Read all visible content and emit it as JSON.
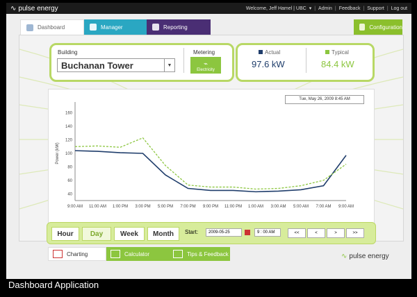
{
  "topbar": {
    "logo": "pulse energy",
    "welcome": "Welcome, Jeff Hamel | UBC",
    "links": [
      "Admin",
      "Feedback",
      "Support",
      "Log out"
    ]
  },
  "tabs": [
    {
      "label": "Dashboard",
      "icon": "dashboard-icon"
    },
    {
      "label": "Manager",
      "icon": "manager-icon"
    },
    {
      "label": "Reporting",
      "icon": "reporting-icon"
    },
    {
      "label": "Configuration",
      "icon": "configuration-icon"
    }
  ],
  "building": {
    "label": "Building",
    "selected": "Buchanan Tower"
  },
  "metering": {
    "label": "Metering",
    "button": "Electricity"
  },
  "actual": {
    "label": "Actual",
    "value": "97.6 kW"
  },
  "typical": {
    "label": "Typical",
    "value": "84.4 kW"
  },
  "chart_timestamp": "Tue, May 26, 2009 8:45 AM",
  "controls": {
    "ranges": [
      "Hour",
      "Day",
      "Week",
      "Month"
    ],
    "active": "Day",
    "start_label": "Start:",
    "start_date": "2009-05-25",
    "start_time": "9 : 00 AM",
    "nav": [
      "<<",
      "<",
      ">",
      ">>"
    ]
  },
  "bottom_tabs": [
    "Charting",
    "Calculator",
    "Tips & Feedback"
  ],
  "bottom_logo": "pulse energy",
  "caption": "Dashboard Application",
  "chart_data": {
    "type": "line",
    "title": "",
    "xlabel": "",
    "ylabel": "Power (kW)",
    "ylim": [
      30,
      170
    ],
    "yticks": [
      40,
      60,
      80,
      100,
      120,
      140,
      160
    ],
    "x": [
      "9:00 AM",
      "11:00 AM",
      "1:00 PM",
      "3:00 PM",
      "5:00 PM",
      "7:00 PM",
      "9:00 PM",
      "11:00 PM",
      "1:00 AM",
      "3:00 AM",
      "5:00 AM",
      "7:00 AM",
      "9:00 AM"
    ],
    "series": [
      {
        "name": "Actual",
        "color": "#1f3d6b",
        "values": [
          104,
          103,
          101,
          100,
          68,
          48,
          45,
          45,
          43,
          44,
          46,
          52,
          97
        ]
      },
      {
        "name": "Typical",
        "color": "#8cc63f",
        "values": [
          110,
          111,
          109,
          123,
          82,
          53,
          50,
          50,
          47,
          48,
          52,
          60,
          84
        ]
      }
    ]
  }
}
